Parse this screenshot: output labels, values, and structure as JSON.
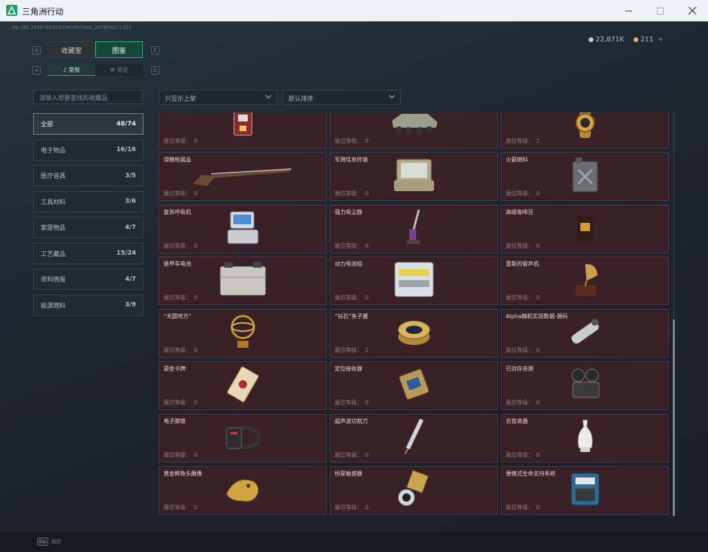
{
  "window": {
    "title": "三角洲行动",
    "minimize_icon": "minimize-icon",
    "maximize_icon": "maximize-icon",
    "close_icon": "close-icon"
  },
  "header": {
    "uid": "CN UID:16297653042261950982_202609171357",
    "currency": [
      {
        "value": "22,871K",
        "color": "#c9ccce"
      },
      {
        "value": "211",
        "color": "#d6b36a",
        "suffix": "+"
      }
    ]
  },
  "tabs": {
    "main": [
      {
        "label": "收藏室",
        "active": false
      },
      {
        "label": "图鉴",
        "active": true
      }
    ],
    "sub": [
      {
        "label": "常规",
        "active": true
      },
      {
        "label": "限定",
        "active": false
      }
    ],
    "key_left": "Q",
    "key_right": "E",
    "sub_key_left": "A",
    "sub_key_right": "D"
  },
  "search": {
    "placeholder": "请输入想要查找的收藏品"
  },
  "filters": {
    "shelf": "只显示上架",
    "sort": "默认排序"
  },
  "categories": [
    {
      "label": "全部",
      "count": "48/74",
      "active": true
    },
    {
      "label": "电子物品",
      "count": "16/16"
    },
    {
      "label": "医疗道具",
      "count": "3/5"
    },
    {
      "label": "工具材料",
      "count": "3/6"
    },
    {
      "label": "家居物品",
      "count": "4/7"
    },
    {
      "label": "工艺藏品",
      "count": "15/24"
    },
    {
      "label": "资料情报",
      "count": "4/7"
    },
    {
      "label": "能源燃料",
      "count": "3/9"
    }
  ],
  "level_label": "展位等级：",
  "items": [
    {
      "name": "",
      "level": "0",
      "icon": "card-reader-icon"
    },
    {
      "name": "",
      "level": "0",
      "icon": "armored-vehicle-icon"
    },
    {
      "name": "",
      "level": "2",
      "icon": "gold-watch-icon"
    },
    {
      "name": "滑膛枪展品",
      "level": "0",
      "icon": "musket-icon"
    },
    {
      "name": "军用信息终端",
      "level": "0",
      "icon": "military-terminal-icon"
    },
    {
      "name": "火箭燃料",
      "level": "0",
      "icon": "fuel-canister-icon"
    },
    {
      "name": "复苏呼吸机",
      "level": "0",
      "icon": "ventilator-icon"
    },
    {
      "name": "强力吸尘器",
      "level": "0",
      "icon": "vacuum-icon"
    },
    {
      "name": "高级咖啡豆",
      "level": "0",
      "icon": "coffee-bag-icon"
    },
    {
      "name": "装甲车电池",
      "level": "0",
      "icon": "vehicle-battery-icon"
    },
    {
      "name": "动力电池组",
      "level": "0",
      "icon": "battery-pack-icon"
    },
    {
      "name": "雷斯的留声机",
      "level": "0",
      "icon": "gramophone-icon"
    },
    {
      "name": "“天圆地方”",
      "level": "0",
      "icon": "armillary-icon"
    },
    {
      "name": "“钻石”鱼子酱",
      "level": "2",
      "icon": "caviar-tin-icon"
    },
    {
      "name": "Alpha精机实验数据-源码",
      "level": "0",
      "icon": "data-drive-icon"
    },
    {
      "name": "鎏金卡牌",
      "level": "0",
      "icon": "gold-card-icon"
    },
    {
      "name": "定位接收器",
      "level": "0",
      "icon": "receiver-icon"
    },
    {
      "name": "已封存音源",
      "level": "0",
      "icon": "projector-icon"
    },
    {
      "name": "电子脚镣",
      "level": "0",
      "icon": "ankle-monitor-icon"
    },
    {
      "name": "超声波切割刀",
      "level": "0",
      "icon": "ultrasonic-cutter-icon"
    },
    {
      "name": "名窑瓷器",
      "level": "0",
      "icon": "porcelain-vase-icon"
    },
    {
      "name": "黄金鳄鱼头雕像",
      "level": "0",
      "icon": "gold-statue-icon"
    },
    {
      "name": "恒星敏感器",
      "level": "0",
      "icon": "star-sensor-icon"
    },
    {
      "name": "便携式生命支持系统",
      "level": "0",
      "icon": "life-support-icon"
    }
  ],
  "footer": {
    "esc_key": "Esc",
    "esc_label": "返回"
  }
}
